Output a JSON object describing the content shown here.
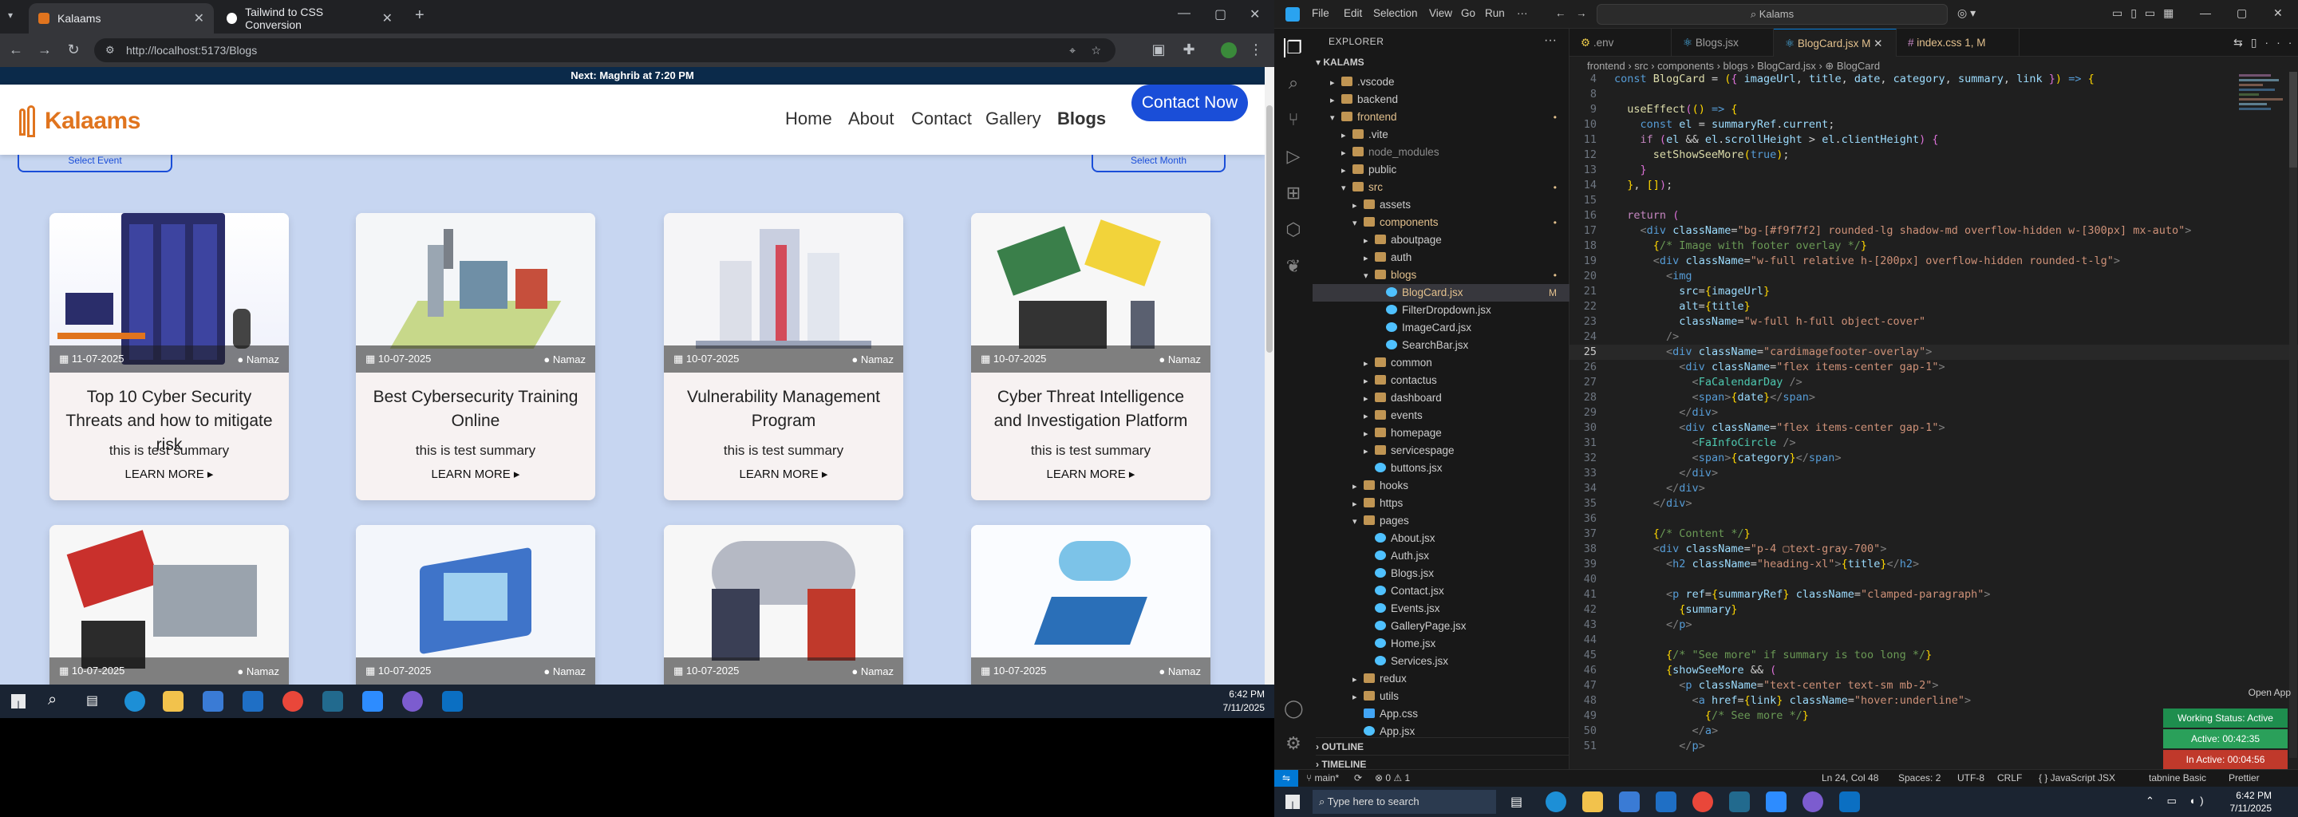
{
  "browser": {
    "tabs": [
      {
        "label": "Kalaams",
        "close": "✕"
      },
      {
        "label": "Tailwind to CSS Conversion",
        "close": "✕"
      }
    ],
    "new_tab": "+",
    "url": "http://localhost:5173/Blogs",
    "marquee": "Next: Maghrib at 7:20 PM",
    "nav": {
      "home": "Home",
      "about": "About",
      "contact": "Contact",
      "gallery": "Gallery",
      "blogs": "Blogs"
    },
    "logo": "Kalaams",
    "cta": "Contact Now",
    "top_pills": [
      "Select Event",
      "Select Month"
    ],
    "cards": [
      {
        "date": "11-07-2025",
        "author": "Namaz",
        "title": "Top 10 Cyber Security Threats and how to mitigate risk",
        "summary": "this is test summary",
        "more": "LEARN MORE ▸",
        "img": "servers"
      },
      {
        "date": "10-07-2025",
        "author": "Namaz",
        "title": "Best Cybersecurity Training Online",
        "summary": "this is test summary",
        "more": "LEARN MORE ▸",
        "img": "factory"
      },
      {
        "date": "10-07-2025",
        "author": "Namaz",
        "title": "Vulnerability Management Program",
        "summary": "this is test summary",
        "more": "LEARN MORE ▸",
        "img": "city"
      },
      {
        "date": "10-07-2025",
        "author": "Namaz",
        "title": "Cyber Threat Intelligence and Investigation Platform",
        "summary": "this is test summary",
        "more": "LEARN MORE ▸",
        "img": "itservice"
      },
      {
        "date": "10-07-2025",
        "author": "Namaz",
        "img": "itservice2"
      },
      {
        "date": "10-07-2025",
        "author": "Namaz",
        "img": "laptop"
      },
      {
        "date": "10-07-2025",
        "author": "Namaz",
        "img": "cloud"
      },
      {
        "date": "10-07-2025",
        "author": "Namaz",
        "img": "screen"
      }
    ],
    "clock": {
      "time": "6:42 PM",
      "date": "7/11/2025"
    }
  },
  "vscode": {
    "menu": [
      "File",
      "Edit",
      "Selection",
      "View",
      "Go",
      "Run"
    ],
    "search": "Kalams",
    "explorer": "EXPLORER",
    "project": "KALAMS",
    "tree": [
      {
        "name": ".vscode",
        "d": 1,
        "t": "folder",
        "c": "▸"
      },
      {
        "name": "backend",
        "d": 1,
        "t": "folder",
        "c": "▸"
      },
      {
        "name": "frontend",
        "d": 1,
        "t": "folder",
        "c": "▾",
        "badge": "•",
        "col": "#e2c08d"
      },
      {
        "name": ".vite",
        "d": 2,
        "t": "folder",
        "c": "▸"
      },
      {
        "name": "node_modules",
        "d": 2,
        "t": "folder",
        "c": "▸",
        "col": "#8c8c8c"
      },
      {
        "name": "public",
        "d": 2,
        "t": "folder",
        "c": "▸"
      },
      {
        "name": "src",
        "d": 2,
        "t": "folder",
        "c": "▾",
        "badge": "•",
        "col": "#e2c08d"
      },
      {
        "name": "assets",
        "d": 3,
        "t": "folder",
        "c": "▸"
      },
      {
        "name": "components",
        "d": 3,
        "t": "folder",
        "c": "▾",
        "badge": "•",
        "col": "#e2c08d"
      },
      {
        "name": "aboutpage",
        "d": 4,
        "t": "folder",
        "c": "▸"
      },
      {
        "name": "auth",
        "d": 4,
        "t": "folder",
        "c": "▸"
      },
      {
        "name": "blogs",
        "d": 4,
        "t": "folder",
        "c": "▾",
        "badge": "•",
        "col": "#e2c08d"
      },
      {
        "name": "BlogCard.jsx",
        "d": 5,
        "t": "jsx",
        "badge": "M",
        "sel": true,
        "col": "#e2c08d"
      },
      {
        "name": "FilterDropdown.jsx",
        "d": 5,
        "t": "jsx"
      },
      {
        "name": "ImageCard.jsx",
        "d": 5,
        "t": "jsx"
      },
      {
        "name": "SearchBar.jsx",
        "d": 5,
        "t": "jsx"
      },
      {
        "name": "common",
        "d": 4,
        "t": "folder",
        "c": "▸"
      },
      {
        "name": "contactus",
        "d": 4,
        "t": "folder",
        "c": "▸"
      },
      {
        "name": "dashboard",
        "d": 4,
        "t": "folder",
        "c": "▸"
      },
      {
        "name": "events",
        "d": 4,
        "t": "folder",
        "c": "▸"
      },
      {
        "name": "homepage",
        "d": 4,
        "t": "folder",
        "c": "▸"
      },
      {
        "name": "servicespage",
        "d": 4,
        "t": "folder",
        "c": "▸"
      },
      {
        "name": "buttons.jsx",
        "d": 4,
        "t": "jsx"
      },
      {
        "name": "hooks",
        "d": 3,
        "t": "folder",
        "c": "▸"
      },
      {
        "name": "https",
        "d": 3,
        "t": "folder",
        "c": "▸"
      },
      {
        "name": "pages",
        "d": 3,
        "t": "folder",
        "c": "▾"
      },
      {
        "name": "About.jsx",
        "d": 4,
        "t": "jsx"
      },
      {
        "name": "Auth.jsx",
        "d": 4,
        "t": "jsx"
      },
      {
        "name": "Blogs.jsx",
        "d": 4,
        "t": "jsx"
      },
      {
        "name": "Contact.jsx",
        "d": 4,
        "t": "jsx"
      },
      {
        "name": "Events.jsx",
        "d": 4,
        "t": "jsx"
      },
      {
        "name": "GalleryPage.jsx",
        "d": 4,
        "t": "jsx"
      },
      {
        "name": "Home.jsx",
        "d": 4,
        "t": "jsx"
      },
      {
        "name": "Services.jsx",
        "d": 4,
        "t": "jsx"
      },
      {
        "name": "redux",
        "d": 3,
        "t": "folder",
        "c": "▸"
      },
      {
        "name": "utils",
        "d": 3,
        "t": "folder",
        "c": "▸"
      },
      {
        "name": "App.css",
        "d": 3,
        "t": "css"
      },
      {
        "name": "App.jsx",
        "d": 3,
        "t": "jsx"
      }
    ],
    "outline": "OUTLINE",
    "timeline": "TIMELINE",
    "tabs": [
      {
        "label": ".env"
      },
      {
        "label": "Blogs.jsx"
      },
      {
        "label": "BlogCard.jsx M",
        "active": true
      },
      {
        "label": "index.css 1, M"
      }
    ],
    "breadcrumb": "frontend › src › components › blogs › BlogCard.jsx › ⊕ BlogCard",
    "code": [
      {
        "n": 4,
        "h": "<span class='kw'>const</span> <span class='f'>BlogCard</span> <span class='w'>=</span> <span class='p'>(</span><span class='pl'>{</span> <span class='v'>imageUrl</span>, <span class='v'>title</span>, <span class='v'>date</span>, <span class='v'>category</span>, <span class='v'>summary</span>, <span class='v'>link</span> <span class='pl'>}</span><span class='p'>)</span> <span class='kw'>=&gt;</span> <span class='p'>{</span>"
      },
      {
        "n": 8,
        "h": ""
      },
      {
        "n": 9,
        "h": "  <span class='f'>useEffect</span><span class='pl'>(</span><span class='p'>()</span> <span class='kw'>=&gt;</span> <span class='p'>{</span>"
      },
      {
        "n": 10,
        "h": "    <span class='kw'>const</span> <span class='v'>el</span> = <span class='v'>summaryRef</span>.<span class='v'>current</span>;"
      },
      {
        "n": 11,
        "h": "    <span class='k'>if</span> <span class='pl'>(</span><span class='v'>el</span> &amp;&amp; <span class='v'>el</span>.<span class='v'>scrollHeight</span> &gt; <span class='v'>el</span>.<span class='v'>clientHeight</span><span class='pl'>)</span> <span class='pl'>{</span>"
      },
      {
        "n": 12,
        "h": "      <span class='f'>setShowSeeMore</span><span class='p'>(</span><span class='kw'>true</span><span class='p'>)</span>;"
      },
      {
        "n": 13,
        "h": "    <span class='pl'>}</span>"
      },
      {
        "n": 14,
        "h": "  <span class='p'>}</span>, <span class='p'>[]</span><span class='pl'>)</span>;"
      },
      {
        "n": 15,
        "h": ""
      },
      {
        "n": 16,
        "h": "  <span class='k'>return</span> <span class='pl'>(</span>"
      },
      {
        "n": 17,
        "h": "    <span class='g'>&lt;</span><span class='kw'>div</span> <span class='v'>className</span>=<span class='s'>\"bg-[#f9f7f2] rounded-lg shadow-md overflow-hidden w-[300px] mx-auto\"</span><span class='g'>&gt;</span>"
      },
      {
        "n": 18,
        "h": "      <span class='p'>{</span><span class='c'>/* Image with footer overlay */</span><span class='p'>}</span>"
      },
      {
        "n": 19,
        "h": "      <span class='g'>&lt;</span><span class='kw'>div</span> <span class='v'>className</span>=<span class='s'>\"w-full relative h-[200px] overflow-hidden rounded-t-lg\"</span><span class='g'>&gt;</span>"
      },
      {
        "n": 20,
        "h": "        <span class='g'>&lt;</span><span class='kw'>img</span>"
      },
      {
        "n": 21,
        "h": "          <span class='v'>src</span>=<span class='p'>{</span><span class='v'>imageUrl</span><span class='p'>}</span>"
      },
      {
        "n": 22,
        "h": "          <span class='v'>alt</span>=<span class='p'>{</span><span class='v'>title</span><span class='p'>}</span>"
      },
      {
        "n": 23,
        "h": "          <span class='v'>className</span>=<span class='s'>\"w-full h-full object-cover\"</span>"
      },
      {
        "n": 24,
        "h": "        <span class='g'>/&gt;</span>"
      },
      {
        "n": 25,
        "h": "        <span class='g'>&lt;</span><span class='kw'>div</span> <span class='v'>className</span>=<span class='s'>\"cardimagefooter-overlay\"</span><span class='g'>&gt;</span>",
        "cur": true
      },
      {
        "n": 26,
        "h": "          <span class='g'>&lt;</span><span class='kw'>div</span> <span class='v'>className</span>=<span class='s'>\"flex items-center gap-1\"</span><span class='g'>&gt;</span>"
      },
      {
        "n": 27,
        "h": "            <span class='g'>&lt;</span><span class='t'>FaCalendarDay</span> <span class='g'>/&gt;</span>"
      },
      {
        "n": 28,
        "h": "            <span class='g'>&lt;</span><span class='kw'>span</span><span class='g'>&gt;</span><span class='p'>{</span><span class='v'>date</span><span class='p'>}</span><span class='g'>&lt;/</span><span class='kw'>span</span><span class='g'>&gt;</span>"
      },
      {
        "n": 29,
        "h": "          <span class='g'>&lt;/</span><span class='kw'>div</span><span class='g'>&gt;</span>"
      },
      {
        "n": 30,
        "h": "          <span class='g'>&lt;</span><span class='kw'>div</span> <span class='v'>className</span>=<span class='s'>\"flex items-center gap-1\"</span><span class='g'>&gt;</span>"
      },
      {
        "n": 31,
        "h": "            <span class='g'>&lt;</span><span class='t'>FaInfoCircle</span> <span class='g'>/&gt;</span>"
      },
      {
        "n": 32,
        "h": "            <span class='g'>&lt;</span><span class='kw'>span</span><span class='g'>&gt;</span><span class='p'>{</span><span class='v'>category</span><span class='p'>}</span><span class='g'>&lt;/</span><span class='kw'>span</span><span class='g'>&gt;</span>"
      },
      {
        "n": 33,
        "h": "          <span class='g'>&lt;/</span><span class='kw'>div</span><span class='g'>&gt;</span>"
      },
      {
        "n": 34,
        "h": "        <span class='g'>&lt;/</span><span class='kw'>div</span><span class='g'>&gt;</span>"
      },
      {
        "n": 35,
        "h": "      <span class='g'>&lt;/</span><span class='kw'>div</span><span class='g'>&gt;</span>"
      },
      {
        "n": 36,
        "h": ""
      },
      {
        "n": 37,
        "h": "      <span class='p'>{</span><span class='c'>/* Content */</span><span class='p'>}</span>"
      },
      {
        "n": 38,
        "h": "      <span class='g'>&lt;</span><span class='kw'>div</span> <span class='v'>className</span>=<span class='s'>\"p-4 ▢text-gray-700\"</span><span class='g'>&gt;</span>"
      },
      {
        "n": 39,
        "h": "        <span class='g'>&lt;</span><span class='kw'>h2</span> <span class='v'>className</span>=<span class='s'>\"heading-xl\"</span><span class='g'>&gt;</span><span class='p'>{</span><span class='v'>title</span><span class='p'>}</span><span class='g'>&lt;/</span><span class='kw'>h2</span><span class='g'>&gt;</span>"
      },
      {
        "n": 40,
        "h": ""
      },
      {
        "n": 41,
        "h": "        <span class='g'>&lt;</span><span class='kw'>p</span> <span class='v'>ref</span>=<span class='p'>{</span><span class='v'>summaryRef</span><span class='p'>}</span> <span class='v'>className</span>=<span class='s'>\"clamped-paragraph\"</span><span class='g'>&gt;</span>"
      },
      {
        "n": 42,
        "h": "          <span class='p'>{</span><span class='v'>summary</span><span class='p'>}</span>"
      },
      {
        "n": 43,
        "h": "        <span class='g'>&lt;/</span><span class='kw'>p</span><span class='g'>&gt;</span>"
      },
      {
        "n": 44,
        "h": ""
      },
      {
        "n": 45,
        "h": "        <span class='p'>{</span><span class='c'>/* \"See more\" if summary is too long */</span><span class='p'>}</span>"
      },
      {
        "n": 46,
        "h": "        <span class='p'>{</span><span class='v'>showSeeMore</span> &amp;&amp; <span class='pl'>(</span>"
      },
      {
        "n": 47,
        "h": "          <span class='g'>&lt;</span><span class='kw'>p</span> <span class='v'>className</span>=<span class='s'>\"text-center text-sm mb-2\"</span><span class='g'>&gt;</span>"
      },
      {
        "n": 48,
        "h": "            <span class='g'>&lt;</span><span class='kw'>a</span> <span class='v'>href</span>=<span class='p'>{</span><span class='v'>link</span><span class='p'>}</span> <span class='v'>className</span>=<span class='s'>\"hover:underline\"</span><span class='g'>&gt;</span>"
      },
      {
        "n": 49,
        "h": "              <span class='p'>{</span><span class='c'>/* See more */</span><span class='p'>}</span>"
      },
      {
        "n": 50,
        "h": "            <span class='g'>&lt;/</span><span class='kw'>a</span><span class='g'>&gt;</span>"
      },
      {
        "n": 51,
        "h": "          <span class='g'>&lt;/</span><span class='kw'>p</span><span class='g'>&gt;</span>"
      }
    ],
    "status": {
      "branch": "main*",
      "sync": "⟳",
      "problems": "⊗ 0 ⚠ 1",
      "pos": "Ln 24, Col 48",
      "spaces": "Spaces: 2",
      "enc": "UTF-8",
      "eol": "CRLF",
      "lang": "{ } JavaScript JSX",
      "prettier": "tabnine Basic",
      "bell": "Prettier"
    },
    "timer": {
      "app": "Open App",
      "working": "Working Status: Active",
      "active": "Active: 00:42:35",
      "inactive": "In Active: 00:04:56"
    },
    "search_placeholder": "Type here to search",
    "clock": {
      "time": "6:42 PM",
      "date": "7/11/2025"
    }
  }
}
